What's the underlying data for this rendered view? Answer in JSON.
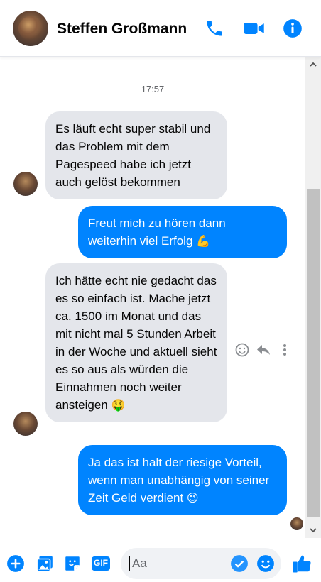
{
  "header": {
    "contact_name": "Steffen Großmann",
    "icons": [
      "phone-icon",
      "video-call-icon",
      "info-icon"
    ]
  },
  "colors": {
    "accent": "#0084ff",
    "incoming_bg": "#e4e6eb",
    "outgoing_text": "#ffffff"
  },
  "thread": {
    "timestamp": "17:57",
    "messages": [
      {
        "direction": "incoming",
        "text": "Es läuft echt super stabil und das Problem mit dem Pagespeed habe ich jetzt auch gelöst bekommen"
      },
      {
        "direction": "outgoing",
        "text": "Freut mich zu hören dann weiterhin viel Erfolg",
        "emoji": "💪"
      },
      {
        "direction": "incoming",
        "text": "Ich hätte echt nie gedacht das es so einfach ist. Mache jetzt ca. 1500 im Monat und das mit nicht mal 5 Stunden Arbeit in der Woche und aktuell sieht es so aus als würden die Einnahmen noch weiter ansteigen",
        "emoji": "🤑"
      },
      {
        "direction": "outgoing",
        "text": "Ja das ist halt der riesige Vorteil, wenn man unabhängig von seiner Zeit Geld verdient",
        "emoji": "😉"
      }
    ],
    "message_actions": [
      "react-icon",
      "reply-icon",
      "more-icon"
    ]
  },
  "composer": {
    "placeholder": "Aa",
    "icons": [
      "plus-icon",
      "photo-icon",
      "sticker-icon",
      "gif-icon",
      "emoji-icon",
      "like-icon"
    ],
    "gif_label": "GIF"
  }
}
